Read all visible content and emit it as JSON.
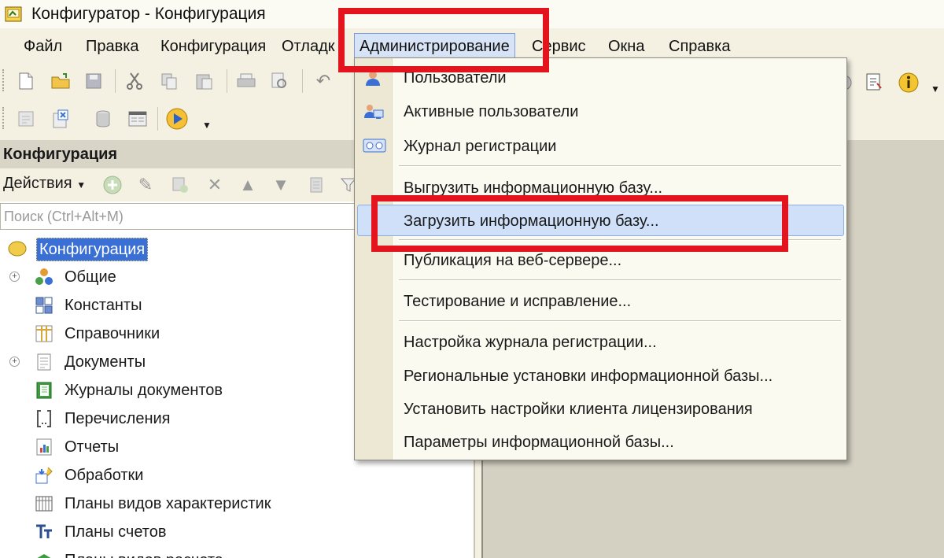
{
  "window": {
    "title": "Конфигуратор - Конфигурация",
    "app_icon": "1c-app-icon"
  },
  "menubar": {
    "items": [
      {
        "label": "Файл"
      },
      {
        "label": "Правка"
      },
      {
        "label": "Конфигурация"
      },
      {
        "label": "Отладк"
      },
      {
        "label": "Администрирование"
      },
      {
        "label": "Сервис"
      },
      {
        "label": "Окна"
      },
      {
        "label": "Справка"
      }
    ],
    "active_index": 4
  },
  "admin_menu": {
    "items": [
      {
        "label": "Пользователи",
        "icon": "user-icon"
      },
      {
        "label": "Активные пользователи",
        "icon": "active-users-icon"
      },
      {
        "label": "Журнал регистрации",
        "icon": "journal-icon"
      },
      {
        "label": "Выгрузить информационную базу..."
      },
      {
        "label": "Загрузить информационную базу..."
      },
      {
        "label": "Публикация на веб-сервере..."
      },
      {
        "label": "Тестирование и исправление..."
      },
      {
        "label": "Настройка журнала регистрации..."
      },
      {
        "label": "Региональные установки информационной базы..."
      },
      {
        "label": "Установить настройки клиента лицензирования"
      },
      {
        "label": "Параметры информационной базы..."
      }
    ],
    "highlighted_index": 4
  },
  "panel": {
    "title": "Конфигурация",
    "actions_label": "Действия",
    "search_placeholder": "Поиск (Ctrl+Alt+M)"
  },
  "tree": {
    "root": "Конфигурация",
    "items": [
      {
        "label": "Общие",
        "icon": "common-icon",
        "expandable": true
      },
      {
        "label": "Константы",
        "icon": "constants-icon",
        "expandable": false
      },
      {
        "label": "Справочники",
        "icon": "catalogs-icon",
        "expandable": false
      },
      {
        "label": "Документы",
        "icon": "documents-icon",
        "expandable": true
      },
      {
        "label": "Журналы документов",
        "icon": "document-journals-icon",
        "expandable": false
      },
      {
        "label": "Перечисления",
        "icon": "enumerations-icon",
        "expandable": false
      },
      {
        "label": "Отчеты",
        "icon": "reports-icon",
        "expandable": false
      },
      {
        "label": "Обработки",
        "icon": "data-processors-icon",
        "expandable": false
      },
      {
        "label": "Планы видов характеристик",
        "icon": "characteristic-types-icon",
        "expandable": false
      },
      {
        "label": "Планы счетов",
        "icon": "chart-of-accounts-icon",
        "expandable": false
      },
      {
        "label": "Планы видов расчета",
        "icon": "calculation-types-icon",
        "expandable": false
      }
    ]
  },
  "colors": {
    "highlight_red": "#e3141d",
    "selection_blue": "#3a6fd6",
    "menu_hover": "#cfe0f8"
  }
}
